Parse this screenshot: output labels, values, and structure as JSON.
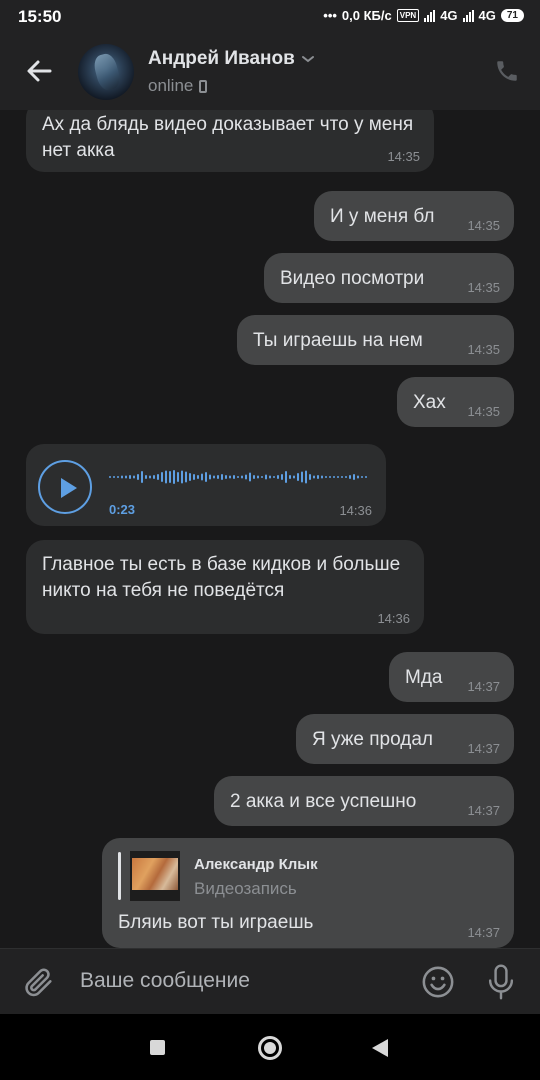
{
  "status_bar": {
    "time": "15:50",
    "net_speed": "0,0 КБ/с",
    "vpn": "VPN",
    "network1": "4G",
    "network2": "4G",
    "battery": "71"
  },
  "header": {
    "name": "Андрей Иванов",
    "status": "online",
    "icons": [
      "back-arrow-icon",
      "chevron-down-icon",
      "mobile-icon",
      "phone-icon"
    ]
  },
  "messages": [
    {
      "dir": "in",
      "text": "Ах да блядь видео доказывает что у меня нет акка",
      "time": "14:35"
    },
    {
      "dir": "out",
      "text": "И у меня бл",
      "time": "14:35"
    },
    {
      "dir": "out",
      "text": "Видео посмотри",
      "time": "14:35"
    },
    {
      "dir": "out",
      "text": "Ты играешь на нем",
      "time": "14:35"
    },
    {
      "dir": "out",
      "text": "Хах",
      "time": "14:35"
    },
    {
      "dir": "in",
      "type": "voice",
      "duration": "0:23",
      "time": "14:36"
    },
    {
      "dir": "in",
      "text": "Главное ты есть в базе кидков и больше никто на тебя не поведётся",
      "time": "14:36"
    },
    {
      "dir": "out",
      "text": "Мда",
      "time": "14:37"
    },
    {
      "dir": "out",
      "text": "Я уже продал",
      "time": "14:37"
    },
    {
      "dir": "out",
      "text": "2 акка и все успешно",
      "time": "14:37"
    },
    {
      "dir": "out",
      "type": "reply",
      "quote_author": "Александр Клык",
      "quote_subtitle": "Видеозапись",
      "text": "Бляиь вот ты играешь",
      "time": "14:37"
    }
  ],
  "input": {
    "placeholder": "Ваше сообщение",
    "icons": [
      "paperclip-icon",
      "smile-icon",
      "microphone-icon"
    ]
  },
  "colors": {
    "background": "#19191a",
    "incoming_bubble": "#2c2d2e",
    "outgoing_bubble": "#454647",
    "accent": "#5e9fe3",
    "muted_text": "#8c8f93"
  }
}
